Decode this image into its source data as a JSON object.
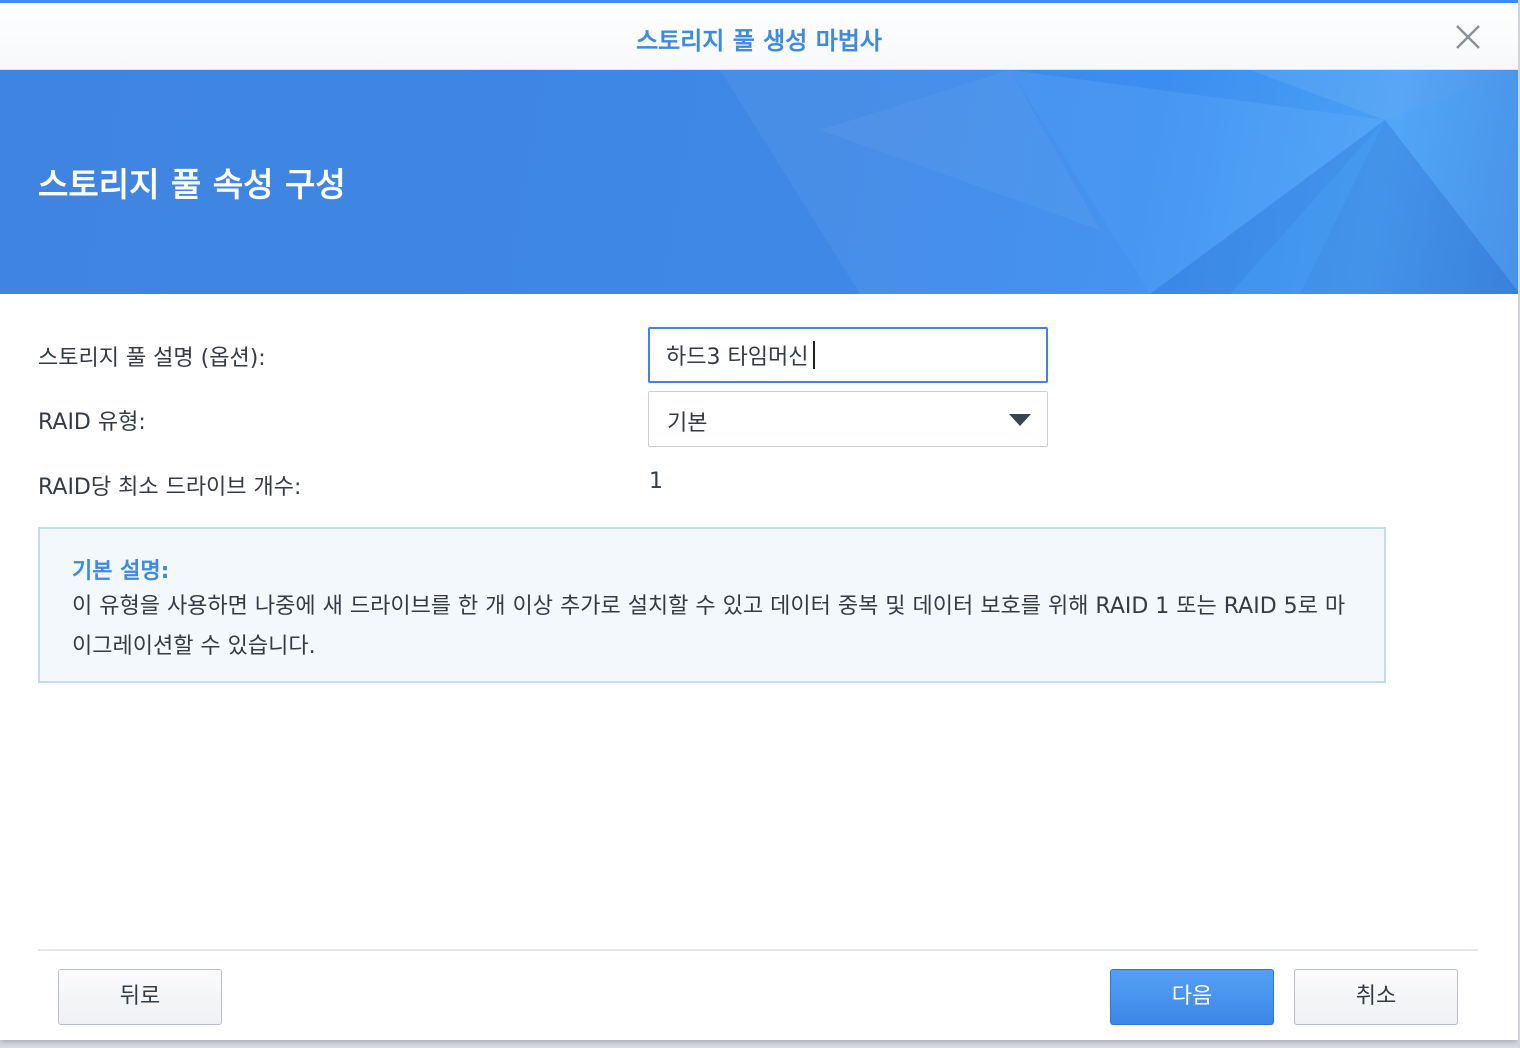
{
  "window": {
    "title": "스토리지 풀 생성 마법사"
  },
  "banner": {
    "title": "스토리지 풀 속성 구성"
  },
  "form": {
    "description_label": "스토리지 풀 설명 (옵션):",
    "description_value": "하드3 타임머신",
    "raid_type_label": "RAID 유형:",
    "raid_type_value": "기본",
    "min_drives_label": "RAID당 최소 드라이브 개수:",
    "min_drives_value": "1"
  },
  "info": {
    "title": "기본 설명:",
    "body": "이 유형을 사용하면 나중에 새 드라이브를 한 개 이상 추가로 설치할 수 있고 데이터 중복 및 데이터 보호를 위해 RAID 1 또는 RAID 5로 마이그레이션할 수 있습니다."
  },
  "footer": {
    "back_label": "뒤로",
    "next_label": "다음",
    "cancel_label": "취소"
  },
  "colors": {
    "accent": "#3d8ae0",
    "banner": "#3f84e0",
    "info_bg": "#f3f8fd",
    "info_border": "#c3dcef"
  },
  "icons": {
    "close": "close-icon",
    "dropdown": "chevron-down-icon"
  }
}
